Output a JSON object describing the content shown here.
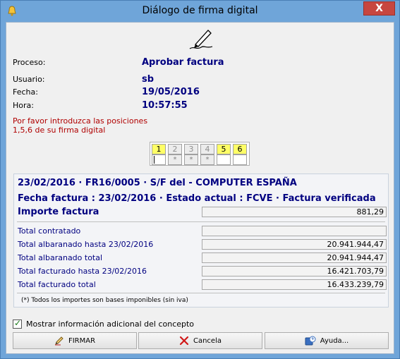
{
  "window": {
    "title": "Diálogo de firma digital",
    "close_glyph": "X"
  },
  "info": {
    "proceso_label": "Proceso:",
    "proceso_value": "Aprobar factura",
    "usuario_label": "Usuario:",
    "usuario_value": "sb",
    "fecha_label": "Fecha:",
    "fecha_value": "19/05/2016",
    "hora_label": "Hora:",
    "hora_value": "10:57:55"
  },
  "prompt": {
    "line1": "Por favor introduzca las posiciones",
    "line2": "1,5,6 de su firma digital"
  },
  "positions": {
    "numbers": [
      "1",
      "2",
      "3",
      "4",
      "5",
      "6"
    ],
    "requested": [
      true,
      false,
      false,
      false,
      true,
      true
    ],
    "inputs": [
      "",
      "*",
      "*",
      "*",
      "",
      ""
    ]
  },
  "details": {
    "header1": "23/02/2016 · FR16/0005 · S/F  del  - COMPUTER ESPAÑA",
    "header2": "Fecha factura : 23/02/2016  ·  Estado actual : FCVE · Factura verificada",
    "importe_label": "Importe factura",
    "importe_value": "881,29",
    "rows": [
      {
        "label": "Total contratado",
        "value": ""
      },
      {
        "label": "Total albaranado hasta 23/02/2016",
        "value": "20.941.944,47"
      },
      {
        "label": "Total albaranado total",
        "value": "20.941.944,47"
      },
      {
        "label": "Total facturado hasta 23/02/2016",
        "value": "16.421.703,79"
      },
      {
        "label": "Total facturado total",
        "value": "16.433.239,79"
      }
    ],
    "note": "(*) Todos los importes son bases imponibles (sin iva)"
  },
  "options": {
    "checkbox_label": "Mostrar información adicional del concepto",
    "checked": true
  },
  "buttons": {
    "firmar": "FIRMAR",
    "cancela": "Cancela",
    "ayuda": "Ayuda..."
  },
  "colors": {
    "title_bar": "#6fa5d9",
    "accent_text": "#000080",
    "warning_text": "#b00000",
    "requested_cell": "#ffff66"
  }
}
